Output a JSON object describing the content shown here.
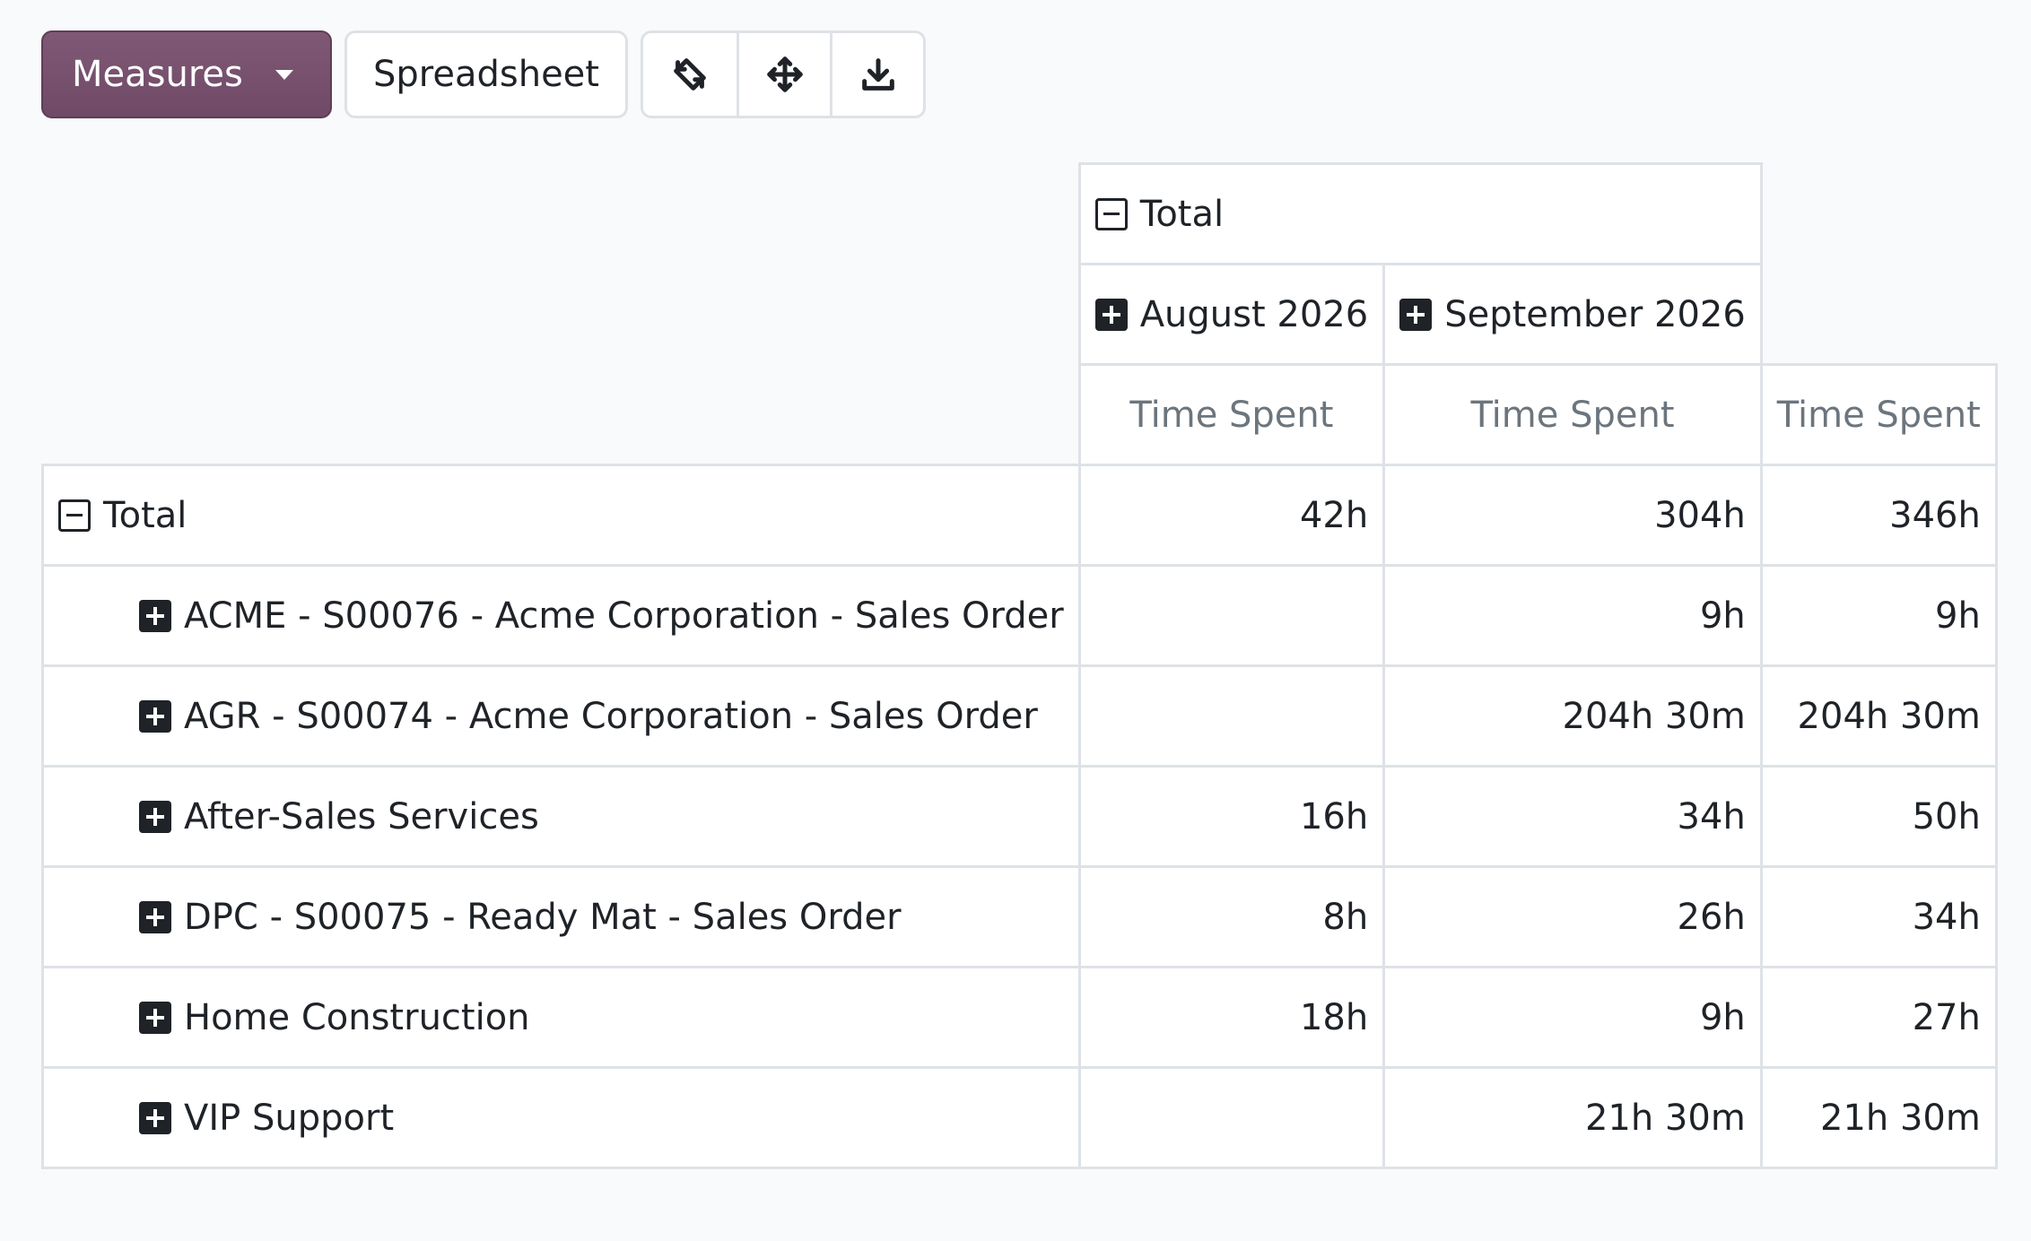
{
  "toolbar": {
    "measures_label": "Measures",
    "spreadsheet_label": "Spreadsheet",
    "icons": [
      "flip-axis-icon",
      "expand-all-icon",
      "download-icon"
    ]
  },
  "pivot": {
    "col_header_total": "Total",
    "col_groups": [
      "August 2026",
      "September 2026"
    ],
    "measure_label": "Time Spent",
    "row_header_total": "Total",
    "totals": {
      "august": "42h",
      "september": "304h",
      "total": "346h"
    },
    "rows": [
      {
        "label": "ACME - S00076 - Acme Corporation - Sales Order",
        "august": "",
        "september": "9h",
        "total": "9h"
      },
      {
        "label": "AGR - S00074 - Acme Corporation - Sales Order",
        "august": "",
        "september": "204h 30m",
        "total": "204h 30m"
      },
      {
        "label": "After-Sales Services",
        "august": "16h",
        "september": "34h",
        "total": "50h"
      },
      {
        "label": "DPC - S00075 - Ready Mat - Sales Order",
        "august": "8h",
        "september": "26h",
        "total": "34h"
      },
      {
        "label": "Home Construction",
        "august": "18h",
        "september": "9h",
        "total": "27h"
      },
      {
        "label": "VIP Support",
        "august": "",
        "september": "21h 30m",
        "total": "21h 30m"
      }
    ]
  },
  "colors": {
    "primary": "#714B67",
    "border": "#dee2e6",
    "muted_text": "#6c757d",
    "background": "#f9fafb"
  }
}
